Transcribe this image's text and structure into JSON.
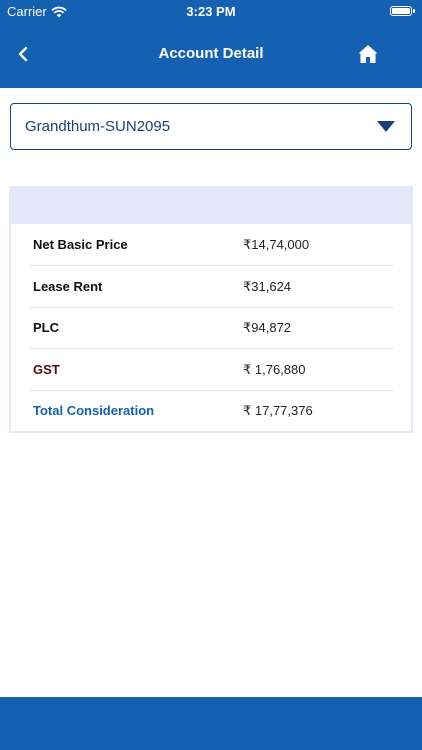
{
  "status_bar": {
    "carrier": "Carrier",
    "time": "3:23 PM"
  },
  "header": {
    "title": "Account Detail",
    "back_icon": "chevron-left-icon",
    "home_icon": "home-icon",
    "background": "#1560b0"
  },
  "dropdown": {
    "selected": "Grandthum-SUN2095",
    "icon": "caret-down-icon"
  },
  "table": {
    "rows": [
      {
        "label": "Net Basic Price",
        "value": "₹14,74,000",
        "label_color": "#111111"
      },
      {
        "label": "Lease Rent",
        "value": "₹31,624",
        "label_color": "#111111"
      },
      {
        "label": "PLC",
        "value": "₹94,872",
        "label_color": "#111111"
      },
      {
        "label": "GST",
        "value": "₹ 1,76,880",
        "label_color": "#4a0f12"
      },
      {
        "label": "Total Consideration",
        "value": "₹ 17,77,376",
        "label_color": "#1560b0"
      }
    ]
  },
  "colors": {
    "primary": "#1560b0",
    "table_band": "#e4e7f7",
    "dropdown_text": "#1b3f7a"
  }
}
